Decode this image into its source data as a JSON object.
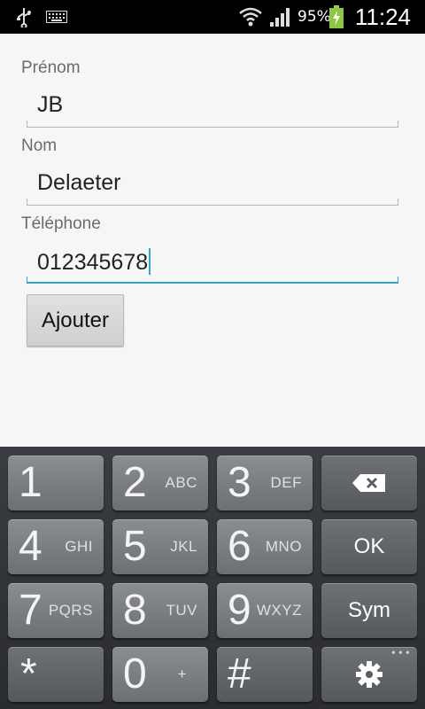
{
  "status_bar": {
    "battery_percent": "95%",
    "time": "11:24",
    "icons": [
      "usb-icon",
      "keyboard-icon",
      "wifi-icon",
      "signal-icon",
      "battery-charging-icon"
    ]
  },
  "form": {
    "first_name": {
      "label": "Prénom",
      "value": "JB"
    },
    "last_name": {
      "label": "Nom",
      "value": "Delaeter"
    },
    "phone": {
      "label": "Téléphone",
      "value": "012345678"
    },
    "add_button": "Ajouter"
  },
  "keypad": {
    "keys": [
      {
        "num": "1",
        "letters": ""
      },
      {
        "num": "2",
        "letters": "ABC"
      },
      {
        "num": "3",
        "letters": "DEF"
      },
      {
        "num": "4",
        "letters": "GHI"
      },
      {
        "num": "5",
        "letters": "JKL"
      },
      {
        "num": "6",
        "letters": "MNO"
      },
      {
        "num": "7",
        "letters": "PQRS"
      },
      {
        "num": "8",
        "letters": "TUV"
      },
      {
        "num": "9",
        "letters": "WXYZ"
      },
      {
        "num": "*",
        "letters": ""
      },
      {
        "num": "0",
        "letters": "+"
      },
      {
        "num": "#",
        "letters": ""
      }
    ],
    "ok_label": "OK",
    "sym_label": "Sym",
    "backspace_icon": "backspace-icon",
    "settings_icon": "gear-icon"
  }
}
